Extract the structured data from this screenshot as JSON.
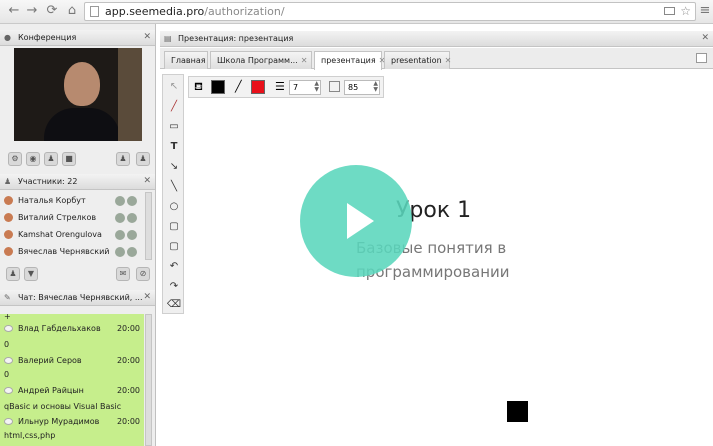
{
  "browser": {
    "url_host": "app.seemedia.pro",
    "url_path": "/authorization/"
  },
  "conference": {
    "title": "Конференция"
  },
  "participants": {
    "title": "Участники: 22",
    "items": [
      {
        "name": "Наталья Корбут"
      },
      {
        "name": "Виталий Стрелков"
      },
      {
        "name": "Kamshat Orengulova"
      },
      {
        "name": "Вячеслав Чернявский"
      }
    ]
  },
  "chat": {
    "title": "Чат: Вячеслав Чернявский, ...",
    "messages": [
      {
        "author": "Влад Габдельхаков",
        "time": "20:00",
        "text": "0"
      },
      {
        "author": "Валерий Серов",
        "time": "20:00",
        "text": "0"
      },
      {
        "author": "Андрей Райцын",
        "time": "20:00",
        "text": "qBasic и основы Visual Basic"
      },
      {
        "author": "Ильнур Мурадимов",
        "time": "20:00",
        "text": "html,css,php"
      }
    ],
    "first_line": "+"
  },
  "presentation_panel": {
    "title": "Презентация: презентация"
  },
  "tabs": [
    {
      "label": "Главная",
      "closable": false
    },
    {
      "label": "Школа Программ...",
      "closable": true
    },
    {
      "label": "презентация",
      "closable": true,
      "active": true
    },
    {
      "label": "presentation",
      "closable": true
    }
  ],
  "drawing": {
    "fill_color": "#000000",
    "stroke_color": "#e8101a",
    "line_width": "7",
    "opacity": "85"
  },
  "slide": {
    "title": "Урок 1",
    "subtitle_line1": "Базовые понятия в",
    "subtitle_line2": "программировании"
  },
  "colors": {
    "chat_bg": "#c6ee8c",
    "play_button": "#5ad6bc"
  }
}
